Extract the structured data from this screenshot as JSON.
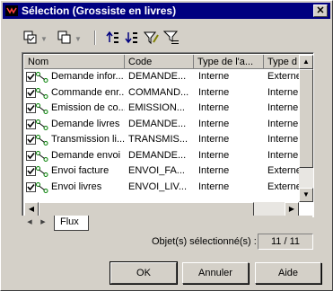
{
  "window": {
    "title": "Sélection (Grossiste en livres)",
    "close_label": "✕"
  },
  "columns": [
    "Nom",
    "Code",
    "Type de l'a...",
    "Type d"
  ],
  "rows": [
    {
      "nom": "Demande infor...",
      "code": "DEMANDE...",
      "type": "Interne",
      "type2": "Externe",
      "checked": true
    },
    {
      "nom": "Commande enr...",
      "code": "COMMAND...",
      "type": "Interne",
      "type2": "Interne",
      "checked": true
    },
    {
      "nom": "Emission de co...",
      "code": "EMISSION...",
      "type": "Interne",
      "type2": "Interne",
      "checked": true
    },
    {
      "nom": "Demande livres",
      "code": "DEMANDE...",
      "type": "Interne",
      "type2": "Interne",
      "checked": true
    },
    {
      "nom": "Transmission li...",
      "code": "TRANSMIS...",
      "type": "Interne",
      "type2": "Interne",
      "checked": true
    },
    {
      "nom": "Demande envoi",
      "code": "DEMANDE...",
      "type": "Interne",
      "type2": "Interne",
      "checked": true
    },
    {
      "nom": "Envoi facture",
      "code": "ENVOI_FA...",
      "type": "Interne",
      "type2": "Externe",
      "checked": true
    },
    {
      "nom": "Envoi livres",
      "code": "ENVOI_LIV...",
      "type": "Interne",
      "type2": "Externe",
      "checked": true
    }
  ],
  "tab": {
    "label": "Flux"
  },
  "status": {
    "label": "Objet(s) sélectionné(s) :",
    "value": "11 / 11"
  },
  "buttons": {
    "ok": "OK",
    "cancel": "Annuler",
    "help": "Aide"
  },
  "colors": {
    "titlebar": "#000080",
    "face": "#d4d0c8",
    "check_green": "#008000"
  }
}
